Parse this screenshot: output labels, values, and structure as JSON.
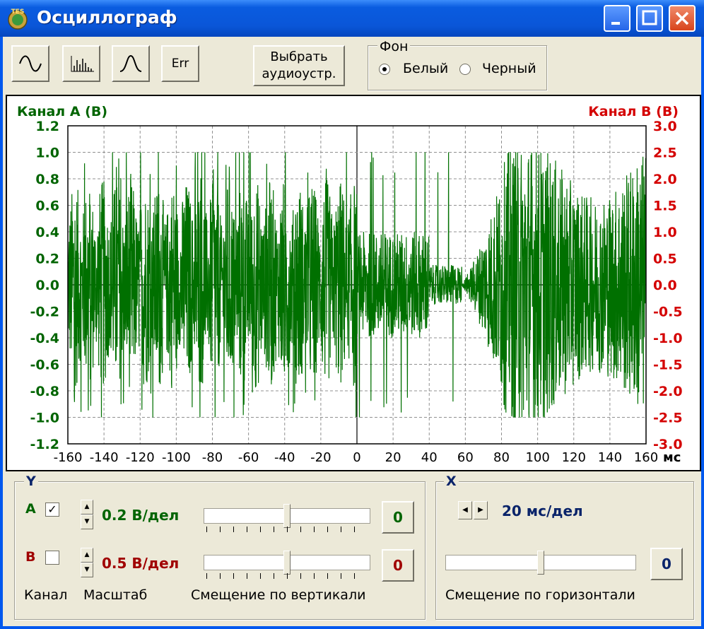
{
  "window": {
    "title": "Осциллограф",
    "icon_label": "TES"
  },
  "toolbar": {
    "buttons": [
      {
        "name": "sine-wave-button",
        "label": "∿"
      },
      {
        "name": "spectrum-button",
        "label": "lıllı."
      },
      {
        "name": "pulse-button",
        "label": "∩"
      },
      {
        "name": "error-button",
        "label": "Err"
      }
    ],
    "device_button_line1": "Выбрать",
    "device_button_line2": "аудиоустр.",
    "background_group": {
      "legend": "Фон",
      "options": [
        {
          "label": "Белый",
          "selected": true
        },
        {
          "label": "Черный",
          "selected": false
        }
      ]
    }
  },
  "chart_data": {
    "type": "line",
    "title_left": "Канал A (B)",
    "title_right": "Канал B (B)",
    "x_unit": "мс",
    "x_ticks": [
      -160,
      -140,
      -120,
      -100,
      -80,
      -60,
      -40,
      -20,
      0,
      20,
      40,
      60,
      80,
      100,
      120,
      140,
      160
    ],
    "y_left_ticks": [
      "1.2",
      "1.0",
      "0.8",
      "0.6",
      "0.4",
      "0.2",
      "0.0",
      "-0.2",
      "-0.4",
      "-0.6",
      "-0.8",
      "-1.0",
      "-1.2"
    ],
    "y_right_ticks": [
      "3.0",
      "2.5",
      "2.0",
      "1.5",
      "1.0",
      "0.5",
      "0.0",
      "-0.5",
      "-1.0",
      "-1.5",
      "-2.0",
      "-2.5",
      "-3.0"
    ],
    "xlim": [
      -160,
      160
    ],
    "ylim_left": [
      -1.2,
      1.2
    ],
    "ylim_right": [
      -3.0,
      3.0
    ],
    "grid": true,
    "series": [
      {
        "channel": "A",
        "color": "#007000",
        "clipped_at": 1.0
      }
    ],
    "colors": {
      "left_axis": "#006400",
      "right_axis": "#d40000",
      "grid": "#909090"
    }
  },
  "y_panel": {
    "legend": "Y",
    "channel_a": {
      "label": "A",
      "checked": true,
      "scale": "0.2 В/дел",
      "offset_value": "0",
      "slider_fraction": 0.5
    },
    "channel_b": {
      "label": "B",
      "checked": false,
      "scale": "0.5 В/дел",
      "offset_value": "0",
      "slider_fraction": 0.5
    },
    "footer_channel": "Канал",
    "footer_scale": "Масштаб",
    "footer_offset": "Смещение по вертикали"
  },
  "x_panel": {
    "legend": "X",
    "scale": "20 мс/дел",
    "offset_value": "0",
    "slider_fraction": 0.5,
    "footer_offset": "Смещение по горизонтали"
  }
}
